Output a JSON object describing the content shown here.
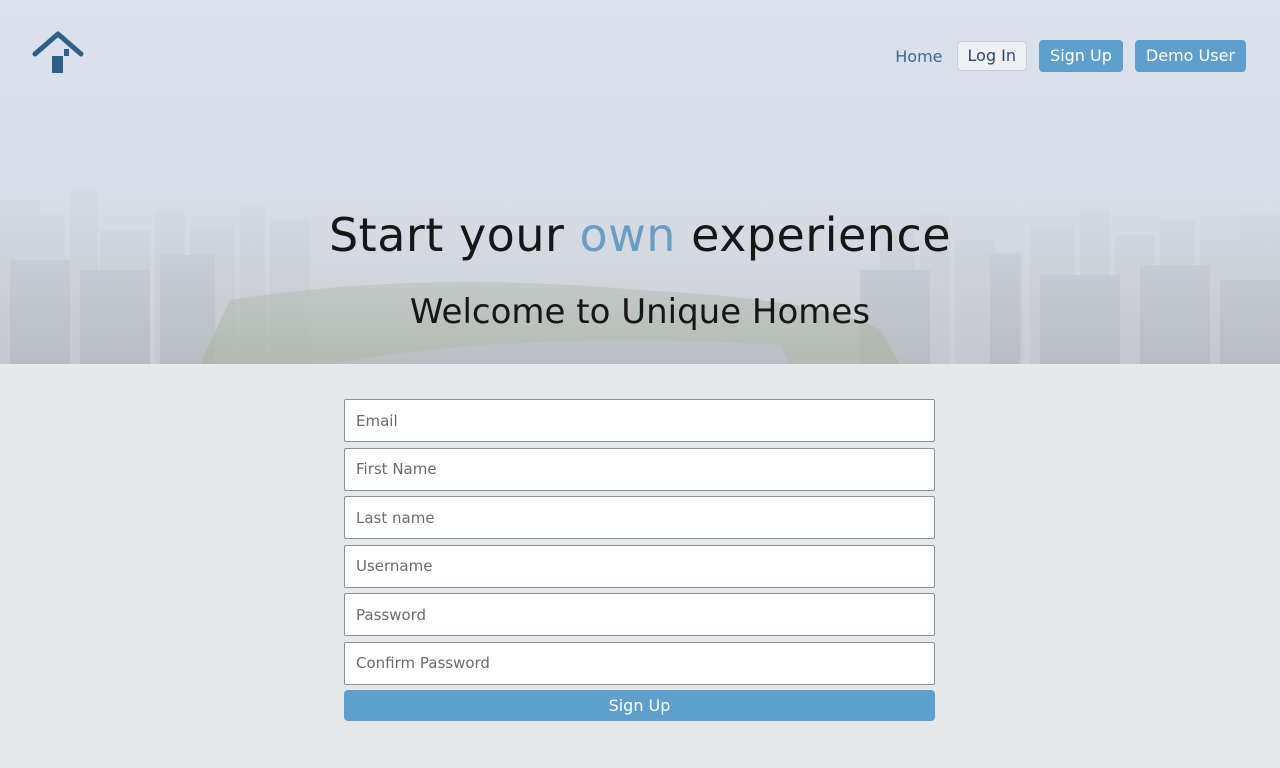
{
  "app": {
    "brand_color": "#2d5f88",
    "accent_color": "#5f9fcd",
    "logo_icon": "house-icon"
  },
  "nav": {
    "home_label": "Home",
    "login_label": "Log In",
    "signup_label": "Sign Up",
    "demo_label": "Demo User"
  },
  "hero": {
    "title_start": "Start your ",
    "title_accent": "own",
    "title_end": " experience",
    "subtitle": "Welcome to Unique Homes"
  },
  "form": {
    "email_placeholder": "Email",
    "first_name_placeholder": "First Name",
    "last_name_placeholder": "Last name",
    "username_placeholder": "Username",
    "password_placeholder": "Password",
    "confirm_password_placeholder": "Confirm Password",
    "submit_label": "Sign Up"
  }
}
